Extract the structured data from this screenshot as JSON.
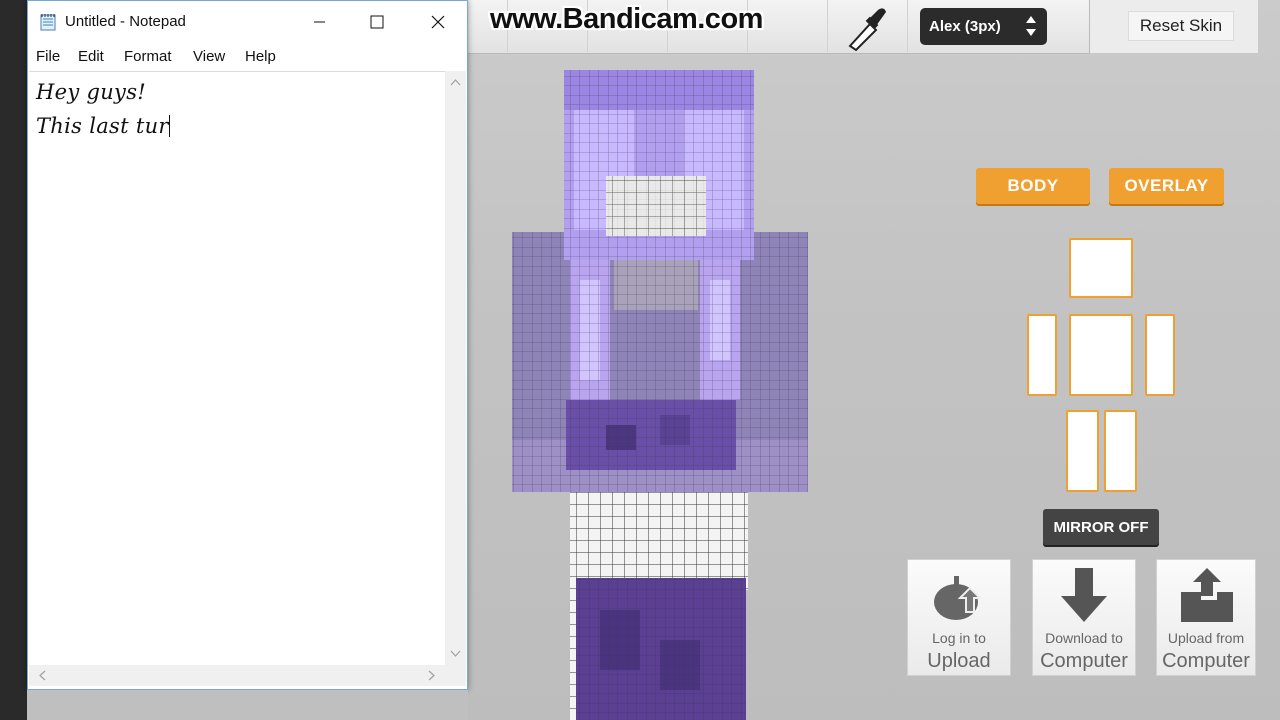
{
  "watermark": "www.Bandicam.com",
  "notepad": {
    "title": "Untitled - Notepad",
    "menu": [
      "File",
      "Edit",
      "Format",
      "View",
      "Help"
    ],
    "lines": [
      "Hey guys!",
      "This last tur"
    ]
  },
  "editor": {
    "skin_select": "Alex (3px)",
    "reset_label": "Reset Skin",
    "body_label": "BODY",
    "overlay_label": "OVERLAY",
    "mirror_label": "MIRROR OFF",
    "buttons": [
      {
        "small": "Log in to",
        "large": "Upload"
      },
      {
        "small": "Download to",
        "large": "Computer"
      },
      {
        "small": "Upload from",
        "large": "Computer"
      }
    ],
    "colors": {
      "accent": "#f0a030",
      "skin_purple": "#8f84b8",
      "hair": "#b9a4f0",
      "pants": "#5a3f93"
    }
  }
}
